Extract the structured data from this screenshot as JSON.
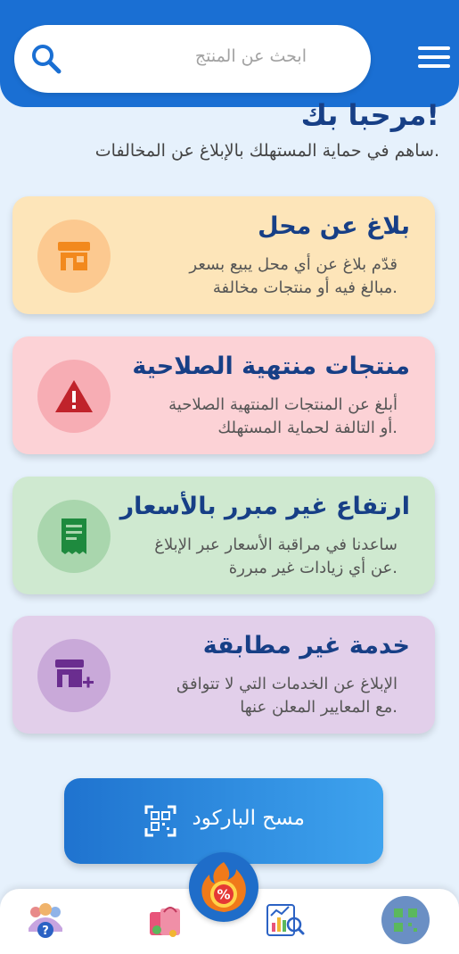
{
  "search": {
    "placeholder": "ابحث عن المنتج"
  },
  "header": {
    "welcome": "!مرحبا بك",
    "subtitle": ".ساهم في حماية المستهلك بالإبلاغ عن المخالفات"
  },
  "cards": [
    {
      "title": "بلاغ عن محل",
      "desc_line1": "قدّم بلاغ عن أي محل يبيع بسعر",
      "desc_line2": ".مبالغ فيه أو منتجات مخالفة",
      "icon": "store-icon",
      "bg": "#fde5b9",
      "circle": "#fcc990",
      "icon_color": "#f2891d"
    },
    {
      "title": "منتجات منتهية الصلاحية",
      "desc_line1": "أبلغ عن المنتجات المنتهية الصلاحية",
      "desc_line2": ".أو التالفة لحماية المستهلك",
      "icon": "warning-icon",
      "bg": "#fcd2d6",
      "circle": "#f7adb4",
      "icon_color": "#c0232b"
    },
    {
      "title": "ارتفاع غير مبرر بالأسعار",
      "desc_line1": "ساعدنا في مراقبة الأسعار عبر الإبلاغ",
      "desc_line2": ".عن أي زيادات غير مبررة",
      "icon": "receipt-icon",
      "bg": "#cfe9d0",
      "circle": "#a9d6ad",
      "icon_color": "#1e8a3e"
    },
    {
      "title": "خدمة غير مطابقة",
      "desc_line1": "الإبلاغ عن الخدمات التي لا تتوافق",
      "desc_line2": ".مع المعايير المعلن عنها",
      "icon": "store-add-icon",
      "bg": "#e2cfea",
      "circle": "#c9a9d9",
      "icon_color": "#6a2d8f"
    }
  ],
  "scan": {
    "label": "مسح الباركود",
    "icon": "qr-scan-icon"
  },
  "nav": {
    "items": [
      "help-community-icon",
      "shopping-icon",
      "analytics-icon",
      "qr-app-icon"
    ],
    "promo_badge": "%"
  },
  "colors": {
    "primary": "#1a6fd3",
    "title": "#173f86",
    "background": "#e6f1fc"
  }
}
